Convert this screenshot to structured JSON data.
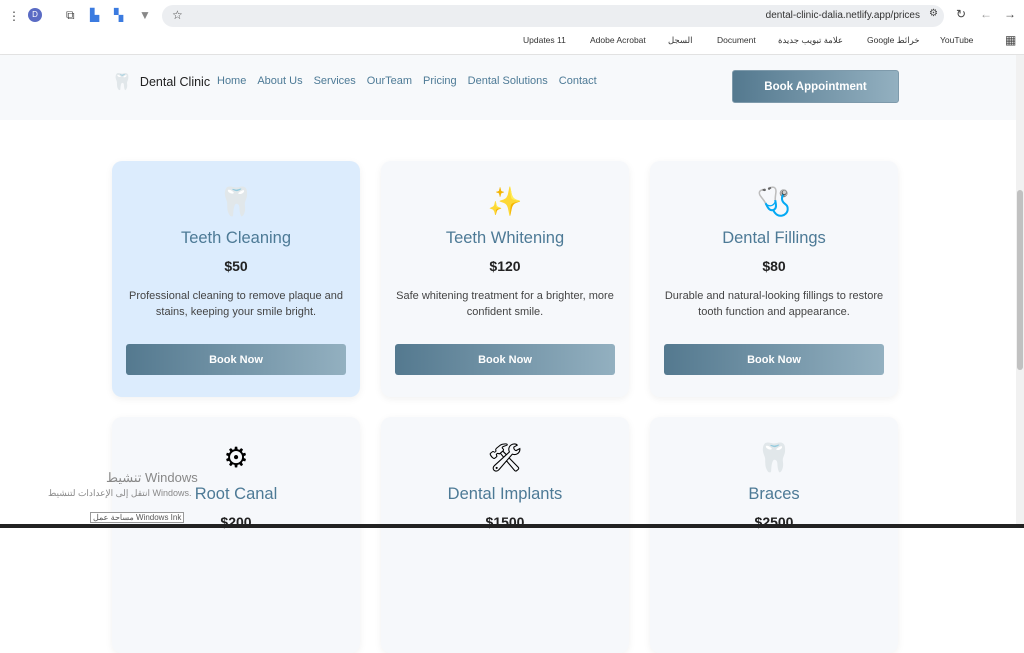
{
  "browser": {
    "profile": "D",
    "url": "dental-clinic-dalia.netlify.app/prices",
    "bookmarks": [
      "Updates 11",
      "Adobe Acrobat",
      "السجل",
      "Document",
      "علامة تبويب جديدة",
      "Google خرائط",
      "YouTube"
    ]
  },
  "nav": {
    "brand": "Dental Clinic",
    "links": [
      "Home",
      "About Us",
      "Services",
      "OurTeam",
      "Pricing",
      "Dental Solutions",
      "Contact"
    ],
    "cta": "Book Appointment"
  },
  "cards": [
    {
      "icon": "🦷",
      "title": "Teeth Cleaning",
      "price": "$50",
      "desc": "Professional cleaning to remove plaque and stains, keeping your smile bright.",
      "button": "Book Now"
    },
    {
      "icon": "✨",
      "title": "Teeth Whitening",
      "price": "$120",
      "desc": "Safe whitening treatment for a brighter, more confident smile.",
      "button": "Book Now"
    },
    {
      "icon": "🩺",
      "title": "Dental Fillings",
      "price": "$80",
      "desc": "Durable and natural-looking fillings to restore tooth function and appearance.",
      "button": "Book Now"
    },
    {
      "icon": "⚙",
      "title": "Root Canal",
      "price": "$200"
    },
    {
      "icon": "🛠",
      "title": "Dental Implants",
      "price": "$1500"
    },
    {
      "icon": "🦷",
      "title": "Braces",
      "price": "$2500"
    }
  ],
  "watermark": {
    "title": "تنشيط Windows",
    "sub": "انتقل إلى الإعدادات لتنشيط Windows.",
    "ink": "مساحة عمل Windows Ink"
  }
}
